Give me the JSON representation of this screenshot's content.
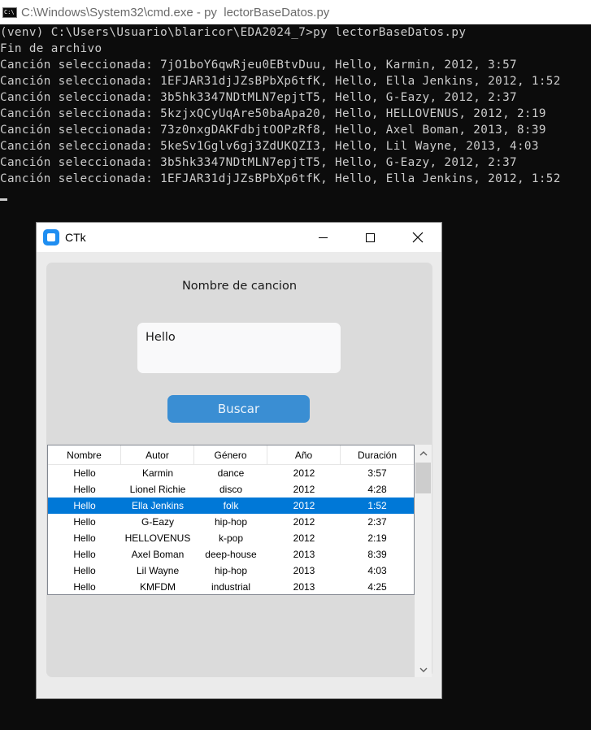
{
  "cmd": {
    "title": "C:\\Windows\\System32\\cmd.exe - py  lectorBaseDatos.py",
    "lines": [
      "(venv) C:\\Users\\Usuario\\blaricor\\EDA2024_7>py lectorBaseDatos.py",
      "Fin de archivo",
      "Canción seleccionada: 7jO1boY6qwRjeu0EBtvDuu, Hello, Karmin, 2012, 3:57",
      "Canción seleccionada: 1EFJAR31djJZsBPbXp6tfK, Hello, Ella Jenkins, 2012, 1:52",
      "Canción seleccionada: 3b5hk3347NDtMLN7epjtT5, Hello, G-Eazy, 2012, 2:37",
      "Canción seleccionada: 5kzjxQCyUqAre50baApa20, Hello, HELLOVENUS, 2012, 2:19",
      "Canción seleccionada: 73z0nxgDAKFdbjtOOPzRf8, Hello, Axel Boman, 2013, 8:39",
      "Canción seleccionada: 5keSv1Gglv6gj3ZdUKQZI3, Hello, Lil Wayne, 2013, 4:03",
      "Canción seleccionada: 3b5hk3347NDtMLN7epjtT5, Hello, G-Eazy, 2012, 2:37",
      "Canción seleccionada: 1EFJAR31djJZsBPbXp6tfK, Hello, Ella Jenkins, 2012, 1:52"
    ]
  },
  "ctk": {
    "title": "CTk",
    "label": "Nombre de cancion",
    "textbox_value": "Hello",
    "button_label": "Buscar",
    "accent": "#3a8ed3",
    "selection_color": "#0078d7",
    "table": {
      "columns": [
        "Nombre",
        "Autor",
        "Género",
        "Año",
        "Duración"
      ],
      "selected_row": 2,
      "rows": [
        [
          "Hello",
          "Karmin",
          "dance",
          "2012",
          "3:57"
        ],
        [
          "Hello",
          "Lionel Richie",
          "disco",
          "2012",
          "4:28"
        ],
        [
          "Hello",
          "Ella Jenkins",
          "folk",
          "2012",
          "1:52"
        ],
        [
          "Hello",
          "G-Eazy",
          "hip-hop",
          "2012",
          "2:37"
        ],
        [
          "Hello",
          "HELLOVENUS",
          "k-pop",
          "2012",
          "2:19"
        ],
        [
          "Hello",
          "Axel Boman",
          "deep-house",
          "2013",
          "8:39"
        ],
        [
          "Hello",
          "Lil Wayne",
          "hip-hop",
          "2013",
          "4:03"
        ],
        [
          "Hello",
          "KMFDM",
          "industrial",
          "2013",
          "4:25"
        ]
      ]
    }
  },
  "icons": {
    "cmd": "terminal-icon",
    "app": "ctk-app-icon",
    "minimize": "minimize-icon",
    "maximize": "maximize-icon",
    "close": "close-icon",
    "scroll_up": "chevron-up-icon",
    "scroll_down": "chevron-down-icon"
  }
}
